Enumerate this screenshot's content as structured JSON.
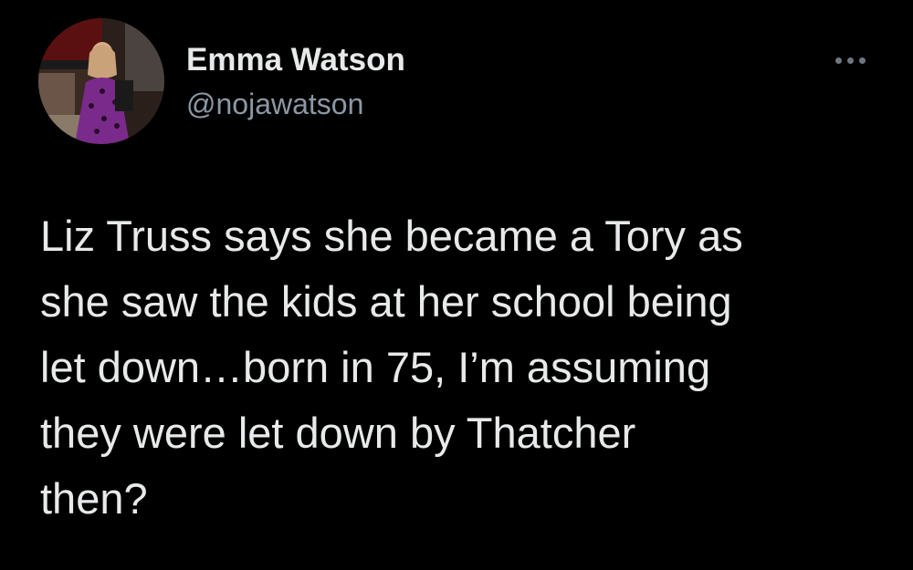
{
  "tweet": {
    "author": {
      "display_name": "Emma Watson",
      "handle": "@nojawatson",
      "avatar_icon": "profile-photo"
    },
    "more_icon": "ellipsis-icon",
    "text": "Liz Truss says she became a Tory as\nshe saw the kids at her school being\nlet down…born in 75, I’m assuming\nthey were let down by Thatcher\nthen?"
  },
  "colors": {
    "background": "#000000",
    "primary_text": "#e7e9ea",
    "secondary_text": "#8b98a5"
  }
}
